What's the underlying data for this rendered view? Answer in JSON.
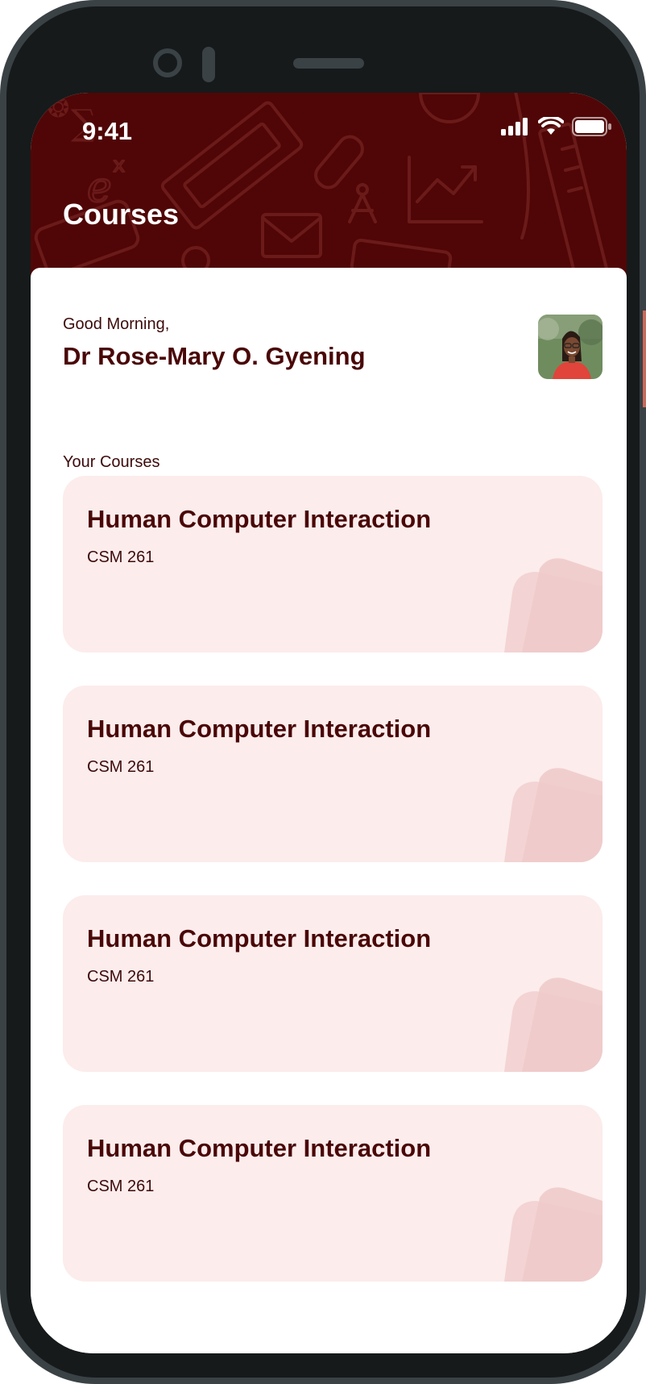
{
  "status_bar": {
    "time": "9:41",
    "icons": [
      "signal-icon",
      "wifi-icon",
      "battery-icon"
    ]
  },
  "header": {
    "title": "Courses",
    "pattern_icons": [
      "euler-e-icon",
      "ticket-icon",
      "envelope-icon",
      "compass-icon",
      "chart-icon",
      "test-tube-icon",
      "globe-icon",
      "ruler-icon"
    ]
  },
  "user": {
    "greeting": "Good Morning,",
    "name": "Dr Rose-Mary O. Gyening",
    "avatar": "profile-photo"
  },
  "courses_section": {
    "label": "Your Courses",
    "items": [
      {
        "title": "Human Computer Interaction",
        "code": "CSM 261"
      },
      {
        "title": "Human Computer Interaction",
        "code": "CSM 261"
      },
      {
        "title": "Human Computer Interaction",
        "code": "CSM 261"
      },
      {
        "title": "Human Computer Interaction",
        "code": "CSM 261"
      }
    ]
  },
  "colors": {
    "header_bg": "#500606",
    "primary_text": "#4a0707",
    "card_bg": "#fcecec",
    "card_deco": "#efc9c9",
    "phone_frame": "#3a4246"
  }
}
